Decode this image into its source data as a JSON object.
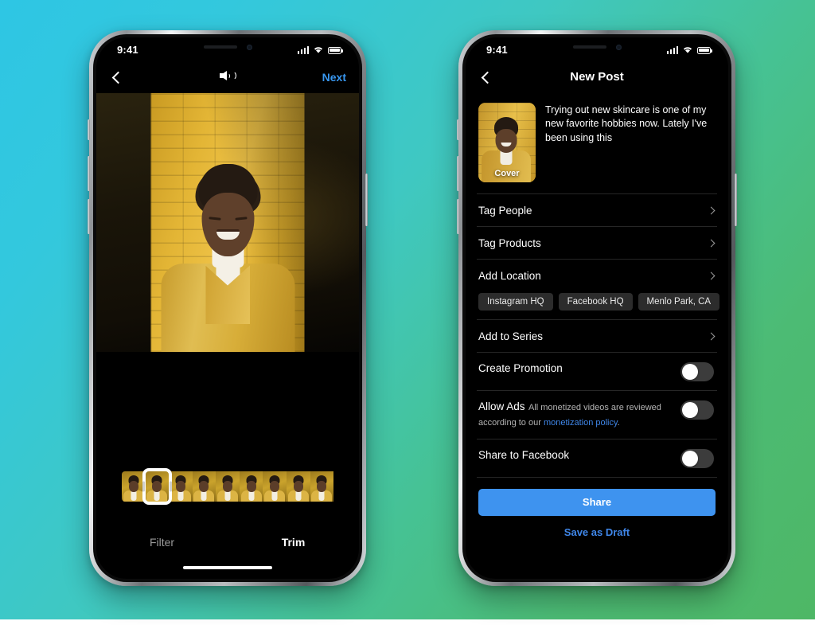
{
  "background": {
    "gradient_from": "#2ec6e4",
    "gradient_to": "#4eb765"
  },
  "phone_left": {
    "status_bar": {
      "time": "9:41",
      "signal_icon": "cellular-bars-icon",
      "wifi_icon": "wifi-icon",
      "battery_icon": "battery-icon"
    },
    "navbar": {
      "back_icon": "chevron-left-icon",
      "center_icon": "speaker-volume-icon",
      "next_label": "Next"
    },
    "media": {
      "cover_alt": "Woman smiling in front of yellow brick wall"
    },
    "filmstrip": {
      "frame_count": 9,
      "selected_frame_index": 1
    },
    "tabs": [
      {
        "label": "Filter",
        "active": false
      },
      {
        "label": "Trim",
        "active": true
      }
    ],
    "home_indicator": true
  },
  "phone_right": {
    "status_bar": {
      "time": "9:41",
      "signal_icon": "cellular-bars-icon",
      "wifi_icon": "wifi-icon",
      "battery_icon": "battery-icon"
    },
    "navbar": {
      "back_icon": "chevron-left-icon",
      "title": "New Post"
    },
    "composer": {
      "cover_label": "Cover",
      "caption": "Trying out new skincare is one of my new favorite hobbies now. Lately I've been using this"
    },
    "rows": [
      {
        "label": "Tag People",
        "type": "disclosure"
      },
      {
        "label": "Tag Products",
        "type": "disclosure"
      },
      {
        "label": "Add Location",
        "type": "disclosure"
      }
    ],
    "location_chips": [
      {
        "label": "Instagram HQ"
      },
      {
        "label": "Facebook HQ"
      },
      {
        "label": "Menlo Park, CA"
      }
    ],
    "series_row": {
      "label": "Add to Series",
      "type": "disclosure"
    },
    "toggles": [
      {
        "label": "Create Promotion",
        "on": false
      },
      {
        "label": "Allow Ads",
        "on": false,
        "subtitle_part1": "All monetized videos are reviewed according to our ",
        "subtitle_link": "monetization policy",
        "subtitle_part2": "."
      },
      {
        "label": "Share to Facebook",
        "on": false
      }
    ],
    "actions": {
      "share_label": "Share",
      "share_color": "#3e93ef",
      "draft_label": "Save as Draft",
      "draft_color": "#3f86e8"
    }
  }
}
